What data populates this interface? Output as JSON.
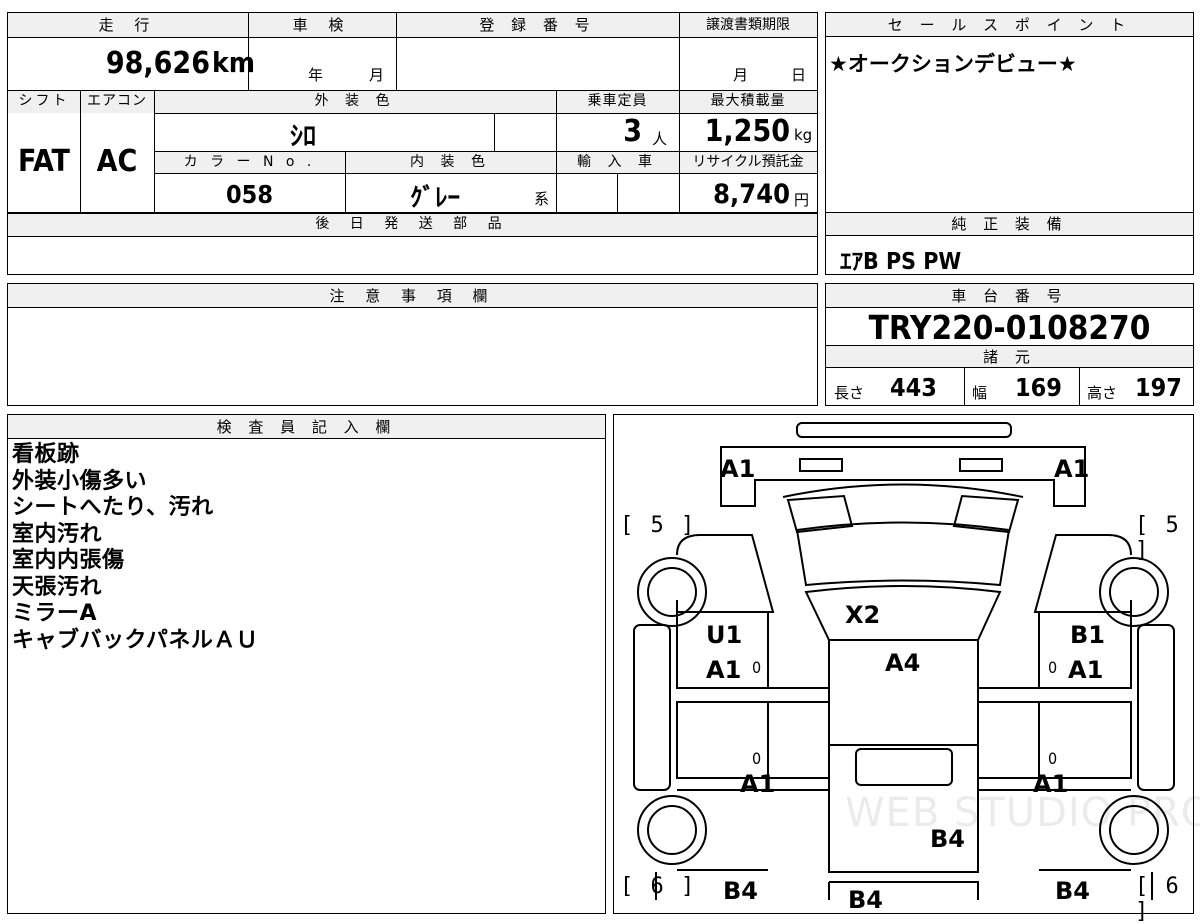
{
  "top_box": {
    "headers": {
      "mileage": "走 行",
      "inspection": "車 検",
      "registration": "登 録 番 号",
      "transfer_deadline": "譲渡書類期限"
    },
    "mileage_value": "98,626",
    "mileage_unit": "km",
    "inspection_year_label": "年",
    "inspection_month_label": "月",
    "deadline_month_label": "月",
    "deadline_day_label": "日",
    "shift_label": "シフト",
    "ac_label": "エアコン",
    "exterior_color_label": "外 装 色",
    "capacity_label": "乗車定員",
    "max_load_label": "最大積載量",
    "shift_value": "FAT",
    "ac_value": "AC",
    "exterior_color_value": "ｼﾛ",
    "capacity_value": "3",
    "capacity_unit": "人",
    "max_load_value": "1,250",
    "max_load_unit": "kg",
    "color_no_label": "カ ラ ー N o .",
    "interior_color_label": "内 装 色",
    "import_label": "輸 入 車",
    "recycle_label": "リサイクル預託金",
    "color_no_value": "058",
    "interior_color_value": "ｸﾞﾚｰ",
    "interior_color_suffix": "系",
    "recycle_value": "8,740",
    "recycle_unit": "円",
    "later_parts_label": "後 日 発 送 部 品"
  },
  "sales_point": {
    "header": "セ ー ル ス ポ イ ン ト",
    "text": "★オークションデビュー★"
  },
  "genuine_equipment": {
    "header": "純 正 装 備",
    "text": "ｴｱB PS PW"
  },
  "notes": {
    "header": "注 意 事 項 欄"
  },
  "chassis": {
    "header": "車 台 番 号",
    "value": "TRY220-0108270"
  },
  "specs": {
    "header": "諸 元",
    "length_label": "長さ",
    "length_value": "443",
    "width_label": "幅",
    "width_value": "169",
    "height_label": "高さ",
    "height_value": "197"
  },
  "inspector": {
    "header": "検 査 員 記 入 欄",
    "lines": [
      "看板跡",
      "外装小傷多い",
      "シートへたり、汚れ",
      "室内汚れ",
      "室内内張傷",
      "天張汚れ",
      "ミラーA",
      "キャブバックパネルＡＵ"
    ]
  },
  "diagram": {
    "bracket_front_left": "[ 5 ]",
    "bracket_front_right": "[ 5 ]",
    "bracket_rear_left": "[ 6 ]",
    "bracket_rear_right": "[ 6 ]",
    "labels": {
      "top_left": "A1",
      "top_right": "A1",
      "windshield": "X2",
      "roof": "A4",
      "left_front_1": "U1",
      "left_front_2": "A1",
      "right_front_1": "B1",
      "right_front_2": "A1",
      "left_mid": "A1",
      "right_mid": "A1",
      "bed": "B4",
      "bottom_left": "B4",
      "bottom_center": "B4",
      "bottom_right": "B4",
      "zero_1": "0",
      "zero_2": "0",
      "zero_3": "0",
      "zero_4": "0"
    },
    "watermark": "WEB STUDIO PRO"
  }
}
